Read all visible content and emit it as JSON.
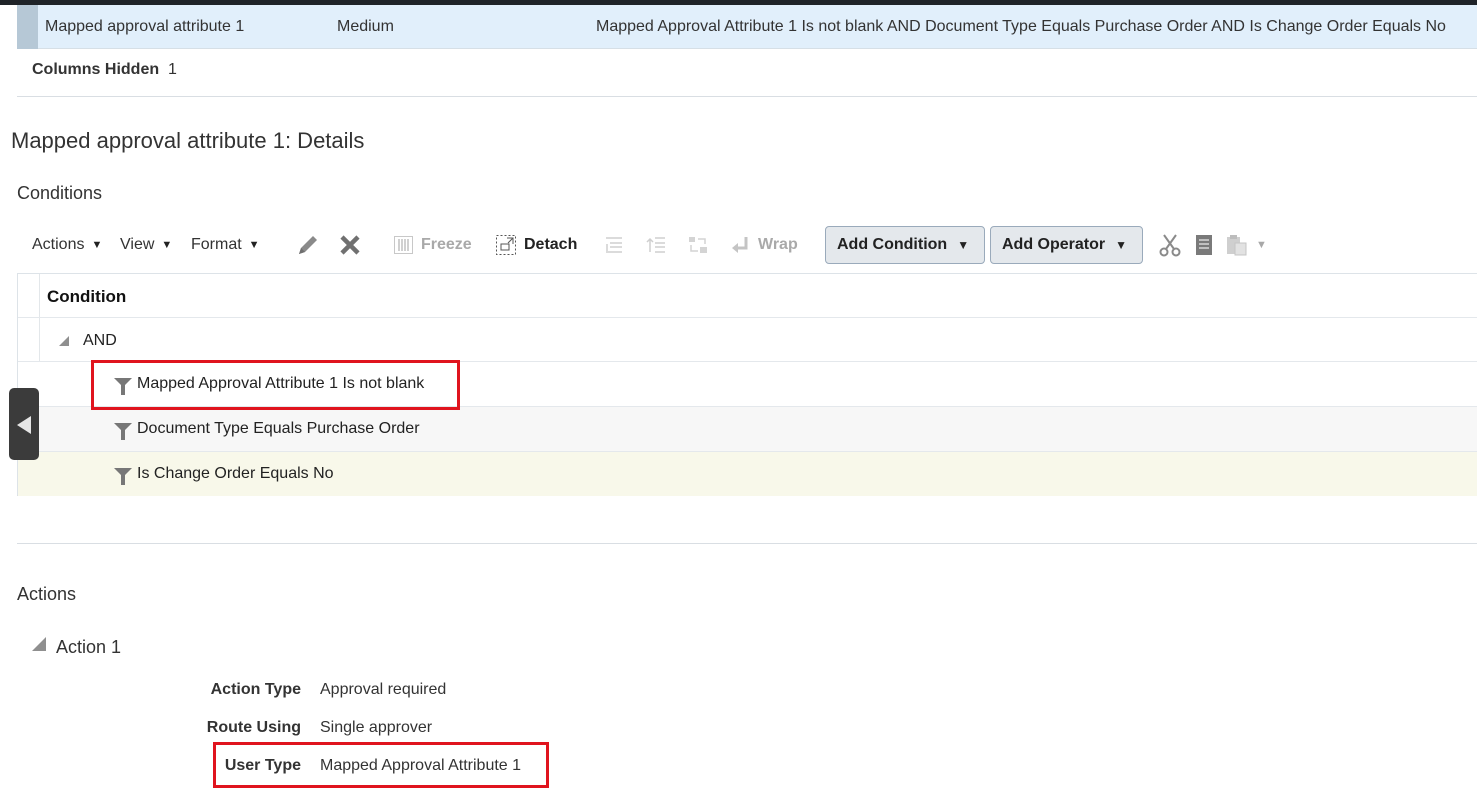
{
  "selected_row": {
    "name": "Mapped approval attribute 1",
    "priority": "Medium",
    "condition_summary": "Mapped Approval Attribute 1 Is not blank AND Document Type Equals Purchase Order AND Is Change Order Equals No"
  },
  "columns_hidden": {
    "label": "Columns Hidden",
    "count": "1"
  },
  "details": {
    "title": "Mapped approval attribute 1: Details",
    "conditions_section": {
      "title": "Conditions",
      "toolbar": {
        "actions_label": "Actions",
        "view_label": "View",
        "format_label": "Format",
        "edit_icon": "pencil-icon",
        "delete_icon": "close-x-icon",
        "freeze_label": "Freeze",
        "detach_label": "Detach",
        "wrap_label": "Wrap",
        "add_condition_label": "Add Condition",
        "add_operator_label": "Add Operator",
        "cut_icon": "scissors-icon",
        "copy_icon": "copy-icon",
        "paste_icon": "paste-icon"
      },
      "table": {
        "column_header": "Condition",
        "operator": "AND",
        "conditions": [
          {
            "text": "Mapped Approval Attribute 1 Is not blank",
            "highlighted": true
          },
          {
            "text": "Document Type Equals Purchase Order",
            "highlighted": false
          },
          {
            "text": "Is Change Order Equals No",
            "highlighted": false
          }
        ]
      }
    },
    "actions_section": {
      "title": "Actions",
      "action": {
        "name": "Action 1",
        "fields": [
          {
            "label": "Action Type",
            "value": "Approval required"
          },
          {
            "label": "Route Using",
            "value": "Single approver"
          },
          {
            "label": "User Type",
            "value": "Mapped Approval Attribute 1"
          }
        ]
      }
    }
  },
  "colors": {
    "highlight_box": "#e0141e",
    "selected_row_bg": "#e1effb",
    "current_row_bg": "#f8f8ea"
  }
}
